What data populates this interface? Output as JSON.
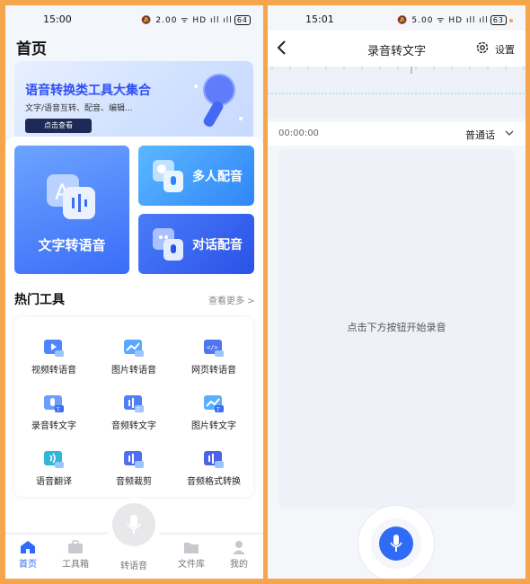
{
  "left": {
    "status": {
      "time": "15:00",
      "icons": "🔕 2.00 ᯤ HD ıll ıll",
      "battery": "64"
    },
    "page_title": "首页",
    "banner": {
      "title": "语音转换类工具大集合",
      "subtitle": "文字/语音互转、配音、编辑...",
      "button": "点击查看"
    },
    "cards": {
      "big": "文字转语音",
      "multi": "多人配音",
      "dialog": "对话配音"
    },
    "hot": {
      "title": "热门工具",
      "more": "查看更多 >"
    },
    "tools": [
      {
        "label": "视频转语音",
        "icon": "video-icon"
      },
      {
        "label": "图片转语音",
        "icon": "image-icon"
      },
      {
        "label": "网页转语音",
        "icon": "webpage-icon"
      },
      {
        "label": "录音转文字",
        "icon": "mic-text-icon"
      },
      {
        "label": "音频转文字",
        "icon": "audio-text-icon"
      },
      {
        "label": "图片转文字",
        "icon": "image-text-icon"
      },
      {
        "label": "语音翻译",
        "icon": "translate-icon"
      },
      {
        "label": "音频裁剪",
        "icon": "crop-icon"
      },
      {
        "label": "音频格式转换",
        "icon": "format-icon"
      }
    ],
    "nav": [
      {
        "label": "首页",
        "icon": "home-icon"
      },
      {
        "label": "工具箱",
        "icon": "toolbox-icon"
      },
      {
        "label": "转语音",
        "icon": "mic-icon"
      },
      {
        "label": "文件库",
        "icon": "folder-icon"
      },
      {
        "label": "我的",
        "icon": "user-icon"
      }
    ]
  },
  "right": {
    "status": {
      "time": "15:01",
      "icons": "🔕 5.00 ᯤ HD ıll ıll",
      "battery": "63"
    },
    "title": "录音转文字",
    "settings": "设置",
    "timer": "00:00:00",
    "language": "普通话",
    "hint": "点击下方按钮开始录音"
  },
  "colors": {
    "accent": "#2f6bf7",
    "frame": "#f5a54c"
  }
}
